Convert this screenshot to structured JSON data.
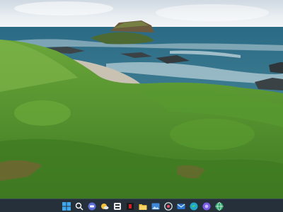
{
  "desktop": {
    "wallpaper": "coastal-landscape-photo",
    "colors": {
      "sky_top": "#e8edf1",
      "sea": "#2f6c86",
      "grass": "#5a9a2c",
      "taskbar": "#25303a"
    }
  },
  "taskbar": {
    "icons": [
      {
        "name": "windows-start-icon",
        "color": "#3fa7ee"
      },
      {
        "name": "search-icon",
        "color": "#ffffff"
      },
      {
        "name": "chat-icon",
        "color": "#5b6ed6"
      },
      {
        "name": "weather-icon",
        "color": "#f2c13a"
      },
      {
        "name": "widgets-icon",
        "color": "#e9e9e9"
      },
      {
        "name": "red-app-icon",
        "color": "#d21d2b"
      },
      {
        "name": "file-explorer-icon",
        "color": "#f3c13a"
      },
      {
        "name": "photos-icon",
        "color": "#3f88d8"
      },
      {
        "name": "media-player-icon",
        "color": "#e8e8e8"
      },
      {
        "name": "mail-icon",
        "color": "#2b79d4"
      },
      {
        "name": "edge-browser-icon",
        "color": "#1fa7c9"
      },
      {
        "name": "copilot-icon",
        "color": "#7a5ce6"
      },
      {
        "name": "globe-app-icon",
        "color": "#2fa36b"
      }
    ]
  }
}
